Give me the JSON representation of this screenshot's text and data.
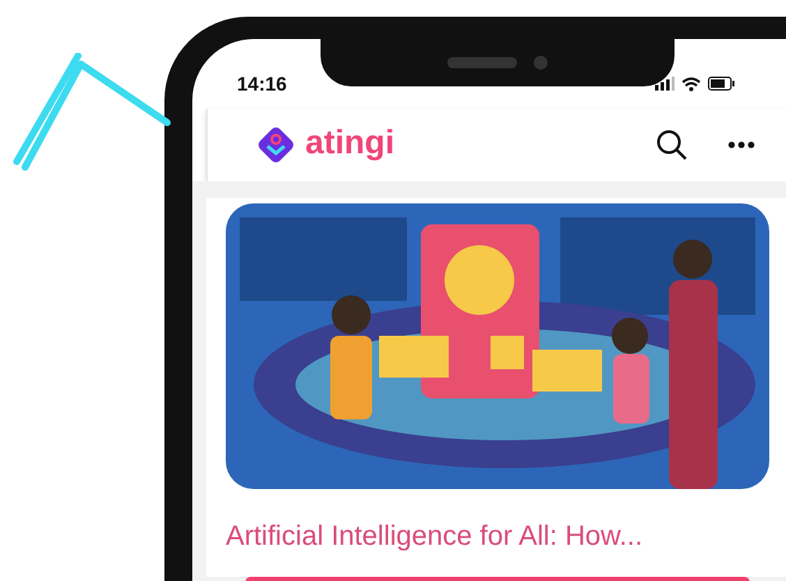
{
  "status_bar": {
    "time": "14:16"
  },
  "app_bar": {
    "logo_text": "atingi"
  },
  "course_card": {
    "title": "Artificial Intelligence for All: How..."
  }
}
